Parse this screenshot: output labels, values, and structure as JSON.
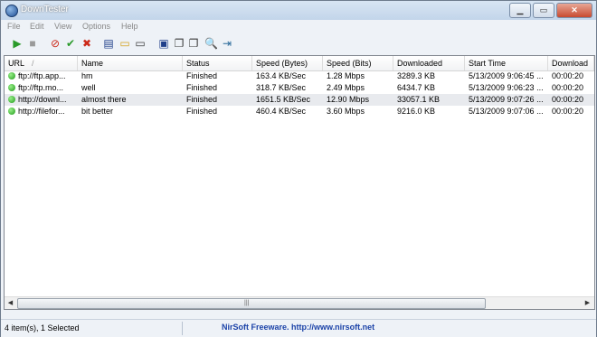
{
  "window": {
    "title": "DownTester",
    "minimize": "▁",
    "maximize": "▭",
    "close": "✕"
  },
  "menu": [
    "File",
    "Edit",
    "View",
    "Options",
    "Help"
  ],
  "toolbar": [
    {
      "icon": "play-icon",
      "glyph": "▶",
      "color": "#2a9a2a"
    },
    {
      "icon": "stop-icon",
      "glyph": "■",
      "color": "#9a9a9a"
    },
    {
      "icon": "cancel-icon",
      "glyph": "⊘",
      "color": "#cc2a1a"
    },
    {
      "icon": "check-icon",
      "glyph": "✔",
      "color": "#2a9a2a"
    },
    {
      "icon": "delete-icon",
      "glyph": "✖",
      "color": "#cc2a1a"
    },
    {
      "icon": "properties-icon",
      "glyph": "▤",
      "color": "#1f3f8a"
    },
    {
      "icon": "folder-icon",
      "glyph": "▭",
      "color": "#d4a21a"
    },
    {
      "icon": "window-icon",
      "glyph": "▭",
      "color": "#3a3a3a"
    },
    {
      "icon": "save-icon",
      "glyph": "▣",
      "color": "#1f3f8a"
    },
    {
      "icon": "copy-icon",
      "glyph": "❐",
      "color": "#3a3a3a"
    },
    {
      "icon": "copy-selected-icon",
      "glyph": "❐",
      "color": "#3a3a3a"
    },
    {
      "icon": "find-icon",
      "glyph": "🔍",
      "color": "#3a3a3a"
    },
    {
      "icon": "exit-icon",
      "glyph": "⇥",
      "color": "#2a6a9a"
    }
  ],
  "columns": [
    {
      "label": "URL",
      "sort": "/"
    },
    {
      "label": "Name"
    },
    {
      "label": "Status"
    },
    {
      "label": "Speed (Bytes)"
    },
    {
      "label": "Speed (Bits)"
    },
    {
      "label": "Downloaded"
    },
    {
      "label": "Start Time"
    },
    {
      "label": "Download"
    }
  ],
  "rows": [
    {
      "url": "ftp://ftp.app...",
      "name": "hm",
      "status": "Finished",
      "speed_bytes": "163.4 KB/Sec",
      "speed_bits": "1.28 Mbps",
      "downloaded": "3289.3 KB",
      "start": "5/13/2009 9:06:45 ...",
      "download": "00:00:20",
      "selected": false
    },
    {
      "url": "ftp://ftp.mo...",
      "name": "well",
      "status": "Finished",
      "speed_bytes": "318.7 KB/Sec",
      "speed_bits": "2.49 Mbps",
      "downloaded": "6434.7 KB",
      "start": "5/13/2009 9:06:23 ...",
      "download": "00:00:20",
      "selected": false
    },
    {
      "url": "http://downl...",
      "name": "almost there",
      "status": "Finished",
      "speed_bytes": "1651.5 KB/Sec",
      "speed_bits": "12.90 Mbps",
      "downloaded": "33057.1 KB",
      "start": "5/13/2009 9:07:26 ...",
      "download": "00:00:20",
      "selected": true
    },
    {
      "url": "http://filefor...",
      "name": "bit better",
      "status": "Finished",
      "speed_bytes": "460.4 KB/Sec",
      "speed_bits": "3.60 Mbps",
      "downloaded": "9216.0 KB",
      "start": "5/13/2009 9:07:06 ...",
      "download": "00:00:20",
      "selected": false
    }
  ],
  "scrollbar": {
    "left_arrow": "◀",
    "right_arrow": "▶",
    "grip": "|||"
  },
  "status": {
    "count": "4 item(s), 1 Selected",
    "link": "NirSoft Freeware.  http://www.nirsoft.net"
  }
}
